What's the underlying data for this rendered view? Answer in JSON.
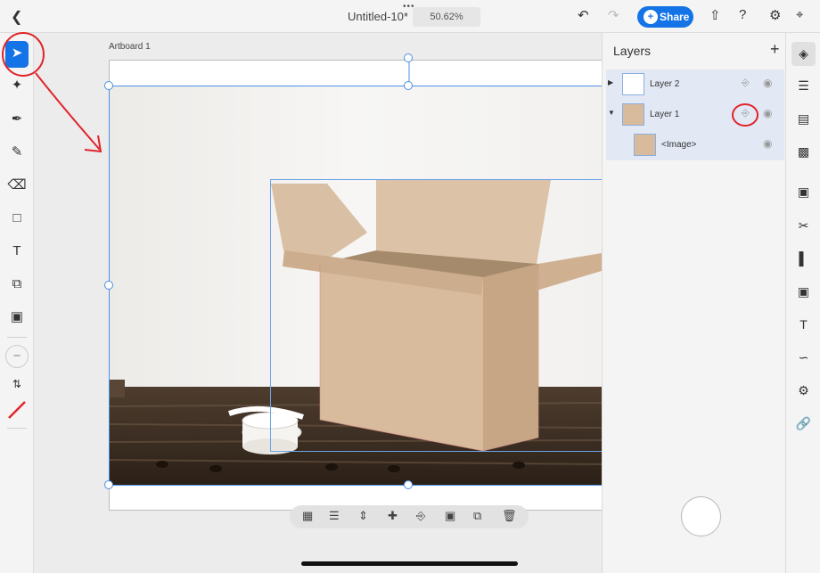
{
  "header": {
    "title": "Untitled-10*",
    "zoom": "50.62%",
    "share_label": "Share"
  },
  "canvas": {
    "artboard_label": "Artboard 1"
  },
  "layers_panel": {
    "title": "Layers",
    "layers": [
      {
        "name": "Layer 2",
        "expanded": false
      },
      {
        "name": "Layer 1",
        "expanded": true
      },
      {
        "name": "<Image>",
        "child": true
      }
    ]
  },
  "icons": {
    "back": "chevron-left-icon",
    "undo": "undo-icon",
    "redo": "redo-icon",
    "export": "export-icon",
    "help": "help-icon",
    "settings": "gear-icon"
  },
  "colors": {
    "accent": "#1473e6",
    "selection": "#4a90e2",
    "annotation": "#e0252b"
  }
}
